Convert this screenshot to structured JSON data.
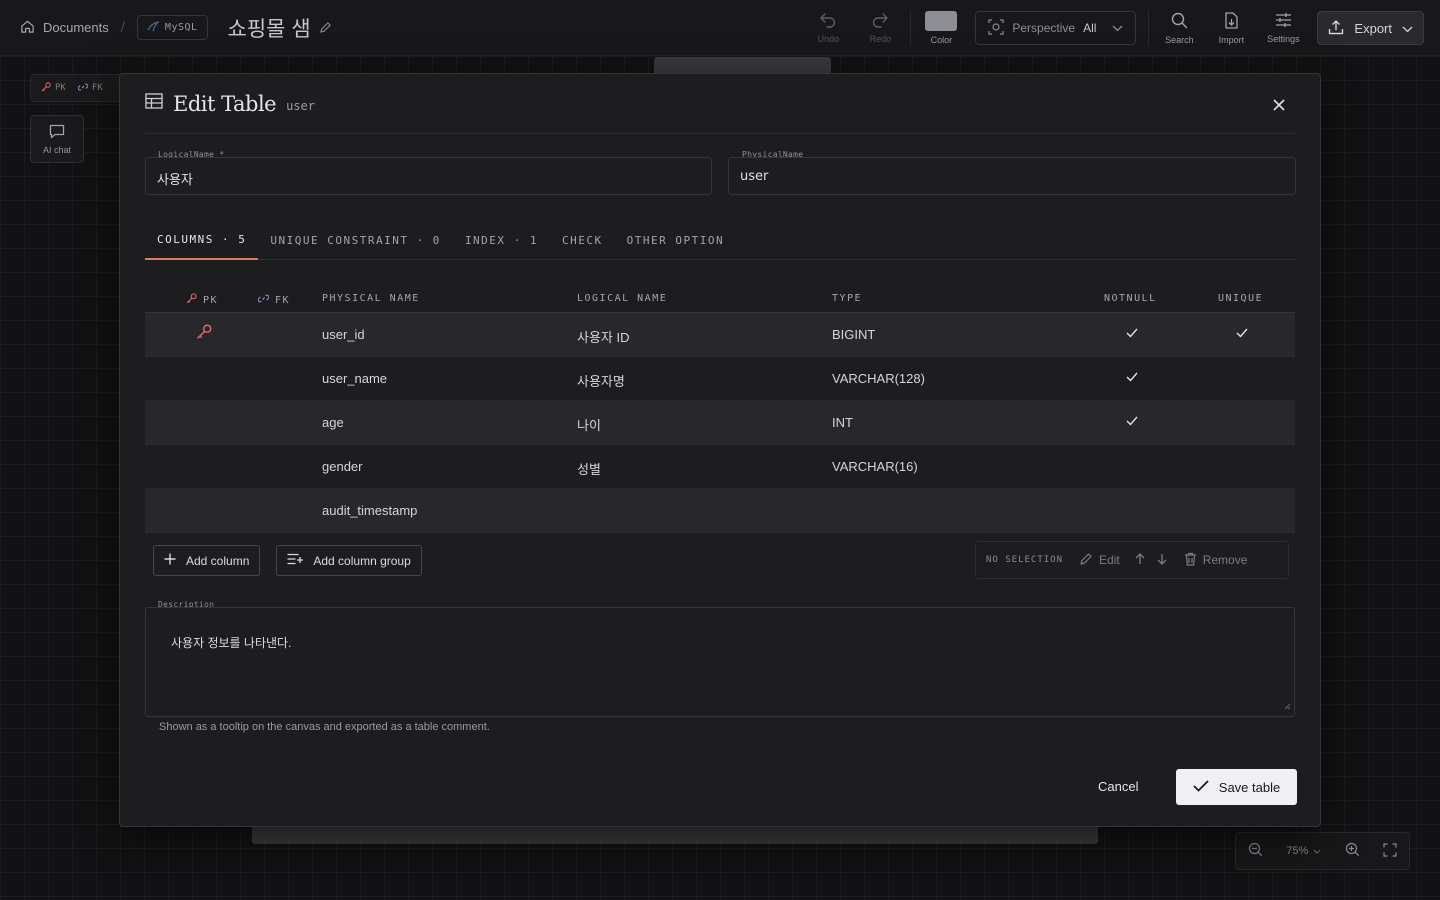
{
  "topbar": {
    "home_label": "Documents",
    "db_label": "MySQL",
    "doc_title": "쇼핑몰 샘",
    "undo_label": "Undo",
    "redo_label": "Redo",
    "color_label": "Color",
    "perspective_label": "Perspective",
    "perspective_value": "All",
    "search_label": "Search",
    "import_label": "Import",
    "settings_label": "Settings",
    "export_label": "Export"
  },
  "canvas": {
    "legend_pk": "PK",
    "legend_fk": "FK",
    "ai_chat_label": "AI chat",
    "zoom_value": "75%"
  },
  "modal": {
    "title": "Edit Table",
    "subtitle": "user",
    "logical_label": "LogicalName *",
    "logical_value": "사용자",
    "physical_label": "PhysicalName",
    "physical_value": "user",
    "tabs": [
      {
        "label": "COLUMNS · 5"
      },
      {
        "label": "UNIQUE CONSTRAINT · 0"
      },
      {
        "label": "INDEX · 1"
      },
      {
        "label": "CHECK"
      },
      {
        "label": "OTHER OPTION"
      }
    ],
    "headers": {
      "pk": "PK",
      "fk": "FK",
      "physical": "PHYSICAL NAME",
      "logical": "LOGICAL NAME",
      "type": "TYPE",
      "notnull": "NOTNULL",
      "unique": "UNIQUE"
    },
    "rows": [
      {
        "physical": "user_id",
        "logical": "사용자 ID",
        "type": "BIGINT",
        "pk": true,
        "notnull": true,
        "unique": true
      },
      {
        "physical": "user_name",
        "logical": "사용자명",
        "type": "VARCHAR(128)",
        "pk": false,
        "notnull": true,
        "unique": false
      },
      {
        "physical": "age",
        "logical": "나이",
        "type": "INT",
        "pk": false,
        "notnull": true,
        "unique": false
      },
      {
        "physical": "gender",
        "logical": "성별",
        "type": "VARCHAR(16)",
        "pk": false,
        "notnull": false,
        "unique": false
      },
      {
        "physical": "audit_timestamp",
        "logical": "",
        "type": "",
        "pk": false,
        "notnull": false,
        "unique": false
      }
    ],
    "add_column_label": "Add column",
    "add_group_label": "Add column group",
    "selection_label": "NO SELECTION",
    "edit_label": "Edit",
    "remove_label": "Remove",
    "description_label": "Description",
    "description_value": "사용자 정보를 나타낸다.",
    "description_hint": "Shown as a tooltip on the canvas and exported as a table comment.",
    "cancel_label": "Cancel",
    "save_label": "Save table"
  },
  "colors": {
    "accent": "#e07a5f",
    "pk_key": "#e06c6c",
    "fk_link": "#8a8fe0",
    "save_bg": "#f0f0f2"
  }
}
